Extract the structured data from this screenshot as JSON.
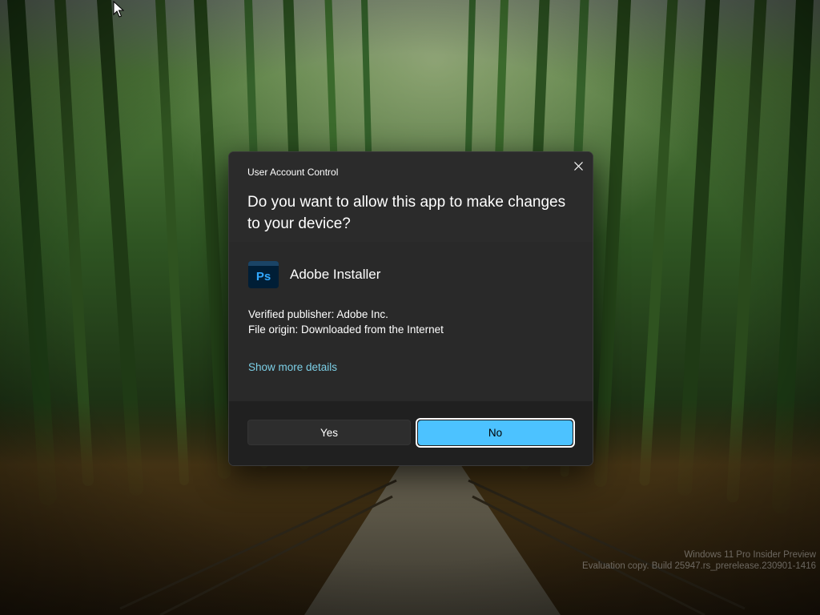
{
  "dialog": {
    "title": "User Account Control",
    "question": "Do you want to allow this app to make changes to your device?",
    "app_name": "Adobe Installer",
    "app_icon": "photoshop-icon",
    "app_icon_text": "Ps",
    "publisher": "Verified publisher: Adobe Inc.",
    "file_origin": "File origin: Downloaded from the Internet",
    "details_link": "Show more details",
    "yes_label": "Yes",
    "no_label": "No"
  },
  "watermark": {
    "line1": "Windows 11 Pro Insider Preview",
    "line2": "Evaluation copy. Build 25947.rs_prerelease.230901-1416"
  },
  "colors": {
    "accent": "#4cc2ff",
    "link": "#7ccfe6",
    "dialog_background": "#202020"
  }
}
